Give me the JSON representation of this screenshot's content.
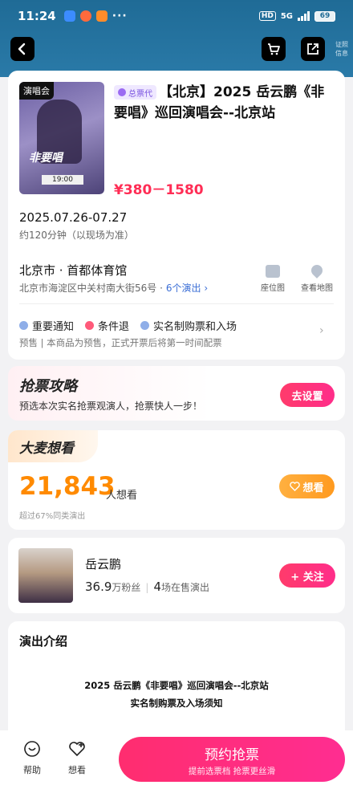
{
  "status_bar": {
    "time": "11:24",
    "hd": "HD",
    "network": "5G",
    "battery": "69",
    "dots": "···"
  },
  "nav": {
    "extra_label": "证照信息"
  },
  "poster": {
    "tag": "演唱会",
    "title_art": "非要唱",
    "time_art": "19:00"
  },
  "show": {
    "agent_badge": "总票代",
    "title": "【北京】2025 岳云鹏《非要唱》巡回演唱会--北京站",
    "price": "¥380－1580",
    "date": "2025.07.26-07.27",
    "duration": "约120分钟（以现场为准）",
    "venue": "北京市 · 首都体育馆",
    "address": "北京市海淀区中关村南大街56号 ·",
    "shows_link": "6个演出 ›",
    "seat_map_label": "座位图",
    "view_map_label": "查看地图",
    "notices": [
      "重要通知",
      "条件退",
      "实名制购票和入场"
    ],
    "presale_note": "预售 | 本商品为预售，正式开票后将第一时间配票"
  },
  "strategy": {
    "title": "抢票攻略",
    "subtitle": "预选本次实名抢票观演人，抢票快人一步！",
    "button": "去设置"
  },
  "want": {
    "tag": "大麦想看",
    "count": "21,843",
    "unit": "人想看",
    "percent_note": "超过67%同类演出",
    "button": "想看"
  },
  "artist": {
    "name": "岳云鹏",
    "fans_num": "36.9",
    "fans_unit": "万粉丝",
    "shows_num": "4",
    "shows_unit": "场在售演出",
    "follow_button": "+ 关注"
  },
  "intro": {
    "title": "演出介绍",
    "line1": "2025 岳云鹏《非要唱》巡回演唱会--北京站",
    "line2": "实名制购票及入场须知"
  },
  "bottom": {
    "help": "帮助",
    "want": "想看",
    "buy_main": "预约抢票",
    "buy_sub": "提前选票档 抢票更丝滑"
  },
  "colors": {
    "accent_pink": "#ff2d6f",
    "want_orange": "#ff8a00",
    "header_blue": "#1f6b96"
  }
}
